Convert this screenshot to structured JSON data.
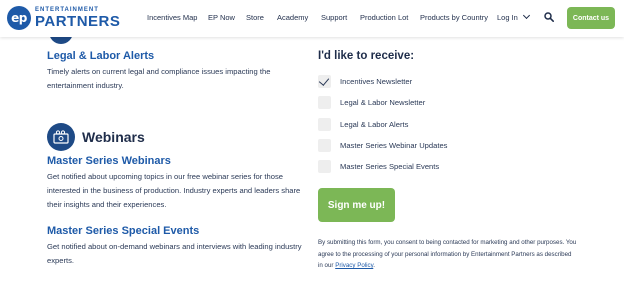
{
  "header": {
    "logo_small": "ENTERTAINMENT",
    "logo_big": "PARTNERS",
    "logo_mark": "ep",
    "nav": [
      "Incentives Map",
      "EP Now",
      "Store",
      "Academy",
      "Support",
      "Production Lot",
      "Products by Country",
      "Log In"
    ],
    "contact_label": "Contact us"
  },
  "left": {
    "legal_title": "Legal & Labor Alerts",
    "legal_desc": "Timely alerts on current legal and compliance issues impacting the entertainment industry.",
    "webinars_title": "Webinars",
    "master_title": "Master Series Webinars",
    "master_desc": "Get notified about upcoming topics in our free webinar series for those interested in the business of production. Industry experts and leaders share their insights and their experiences.",
    "special_title": "Master Series Special Events",
    "special_desc": "Get notified about on-demand webinars and interviews with leading industry experts."
  },
  "form": {
    "title": "I'd like to receive:",
    "options": [
      {
        "label": "Incentives Newsletter",
        "checked": true
      },
      {
        "label": "Legal & Labor Newsletter",
        "checked": false
      },
      {
        "label": "Legal & Labor Alerts",
        "checked": false
      },
      {
        "label": "Master Series Webinar Updates",
        "checked": false
      },
      {
        "label": "Master Series Special Events",
        "checked": false
      }
    ],
    "submit_label": "Sign me up!",
    "consent_text": "By submitting this form, you consent to being contacted for marketing and other purposes. You agree to the processing of your personal information by Entertainment Partners as described in our ",
    "privacy_link": "Privacy Policy",
    "consent_end": "."
  },
  "colors": {
    "brand_blue": "#1e5aa8",
    "navy": "#1e4a86",
    "green": "#7cb756"
  }
}
